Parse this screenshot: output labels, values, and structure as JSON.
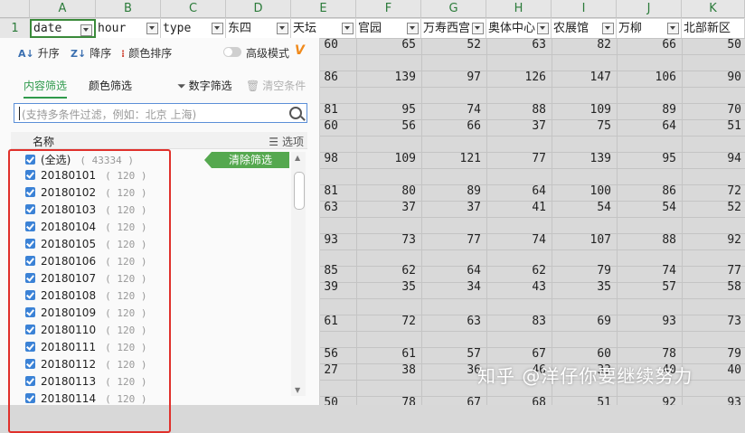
{
  "columns": [
    "A",
    "B",
    "C",
    "D",
    "E",
    "F",
    "G",
    "H",
    "I",
    "J",
    "K"
  ],
  "row_number": "1",
  "headers": [
    "date",
    "hour",
    "type",
    "东四",
    "天坛",
    "官园",
    "万寿西宫",
    "奥体中心",
    "农展馆",
    "万柳",
    "北部新区"
  ],
  "data_rows": [
    [
      "60",
      "65",
      "52",
      "63",
      "82",
      "66",
      "50"
    ],
    [
      "86",
      "139",
      "97",
      "126",
      "147",
      "106",
      "90"
    ],
    [
      "81",
      "95",
      "74",
      "88",
      "109",
      "89",
      "70"
    ],
    [
      "60",
      "56",
      "66",
      "37",
      "75",
      "64",
      "51"
    ],
    [
      "98",
      "109",
      "121",
      "77",
      "139",
      "95",
      "94"
    ],
    [
      "81",
      "80",
      "89",
      "64",
      "100",
      "86",
      "72"
    ],
    [
      "63",
      "37",
      "37",
      "41",
      "54",
      "54",
      "52"
    ],
    [
      "93",
      "73",
      "77",
      "74",
      "107",
      "88",
      "92"
    ],
    [
      "85",
      "62",
      "64",
      "62",
      "79",
      "74",
      "77"
    ],
    [
      "39",
      "35",
      "34",
      "43",
      "35",
      "57",
      "58"
    ],
    [
      "61",
      "72",
      "63",
      "83",
      "69",
      "93",
      "73"
    ],
    [
      "56",
      "61",
      "57",
      "67",
      "60",
      "78",
      "79"
    ],
    [
      "27",
      "38",
      "36",
      "46",
      "33",
      "40",
      "40"
    ],
    [
      "50",
      "78",
      "67",
      "68",
      "51",
      "92",
      "93"
    ]
  ],
  "filter_panel": {
    "sort_asc": "升序",
    "sort_desc": "降序",
    "color_sort": "颜色排序",
    "advanced_mode": "高级模式",
    "tab_content": "内容筛选",
    "tab_color": "颜色筛选",
    "number_filter": "数字筛选",
    "clear_conditions": "清空条件",
    "search_placeholder": "(支持多条件过滤，例如：北京 上海)",
    "list_header": "名称",
    "options_label": "选项",
    "clear_filter": "清除筛选",
    "items": [
      {
        "label": "(全选)",
        "count": "( 43334 )"
      },
      {
        "label": "20180101",
        "count": "( 120 )"
      },
      {
        "label": "20180102",
        "count": "( 120 )"
      },
      {
        "label": "20180103",
        "count": "( 120 )"
      },
      {
        "label": "20180104",
        "count": "( 120 )"
      },
      {
        "label": "20180105",
        "count": "( 120 )"
      },
      {
        "label": "20180106",
        "count": "( 120 )"
      },
      {
        "label": "20180107",
        "count": "( 120 )"
      },
      {
        "label": "20180108",
        "count": "( 120 )"
      },
      {
        "label": "20180109",
        "count": "( 120 )"
      },
      {
        "label": "20180110",
        "count": "( 120 )"
      },
      {
        "label": "20180111",
        "count": "( 120 )"
      },
      {
        "label": "20180112",
        "count": "( 120 )"
      },
      {
        "label": "20180113",
        "count": "( 120 )"
      },
      {
        "label": "20180114",
        "count": "( 120 )"
      }
    ]
  },
  "watermark": "知乎 @洋仔你要继续努力"
}
